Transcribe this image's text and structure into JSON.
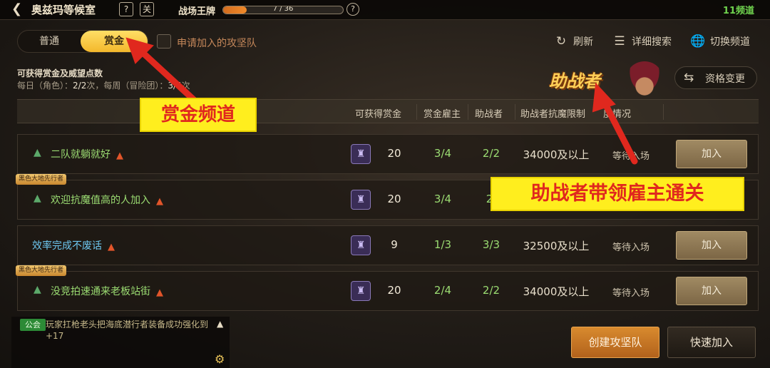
{
  "topbar": {
    "back_icon": "back-arrow-icon",
    "room_title": "奥兹玛等候室",
    "help_glyph": "?",
    "calendar_glyph": "关",
    "rank_label": "战场王牌",
    "rank_progress": "7 / 36",
    "rank_fraction": 0.194,
    "rank_help_glyph": "?",
    "channel": "11频道"
  },
  "mode_toggle": {
    "normal": "普通",
    "bounty": "赏金",
    "selected": "bounty"
  },
  "apply_filter": {
    "label": "申请加入的攻坚队",
    "checked": false
  },
  "actions": {
    "refresh": "刷新",
    "detail_search": "详细搜索",
    "switch_channel": "切换频道"
  },
  "reward_info": {
    "title": "可获得赏金及威望点数",
    "daily_prefix": "每日（角色）：",
    "daily_value": "2/2",
    "daily_suffix": "次，每周（冒险团）：",
    "weekly_value": "3/4",
    "weekly_suffix": "次"
  },
  "helper_badge": "助战者",
  "qualification_button": "资格变更",
  "table": {
    "headers": {
      "reward": "可获得赏金",
      "employer": "赏金雇主",
      "helper": "助战者",
      "limit": "助战者抗魔限制",
      "progress": "度情况"
    },
    "rows": [
      {
        "tag": "",
        "name": "二队就躺就好",
        "name_color": "green",
        "reward": "20",
        "employer": "3/4",
        "helper": "2/2",
        "limit": "34000及以上",
        "status": "等待入场",
        "join": "加入"
      },
      {
        "tag": "黑色大地先行者",
        "name": "欢迎抗魔值高的人加入",
        "name_color": "green",
        "reward": "20",
        "employer": "3/4",
        "helper": "2/",
        "limit": "",
        "status": "",
        "join": ""
      },
      {
        "tag": "",
        "name": "效率完成不废话",
        "name_color": "blue",
        "reward": "9",
        "employer": "1/3",
        "helper": "3/3",
        "limit": "32500及以上",
        "status": "等待入场",
        "join": "加入"
      },
      {
        "tag": "黑色大地先行者",
        "name": "没竞拍速通来老板站街",
        "name_color": "green",
        "reward": "20",
        "employer": "2/4",
        "helper": "2/2",
        "limit": "34000及以上",
        "status": "等待入场",
        "join": "加入"
      }
    ]
  },
  "chat": {
    "guild_tag": "公会",
    "message": "玩家扛枪老头把海底潜行者装备成功强化到+17"
  },
  "buttons": {
    "create": "创建攻坚队",
    "quick_join": "快速加入"
  },
  "annotations": {
    "bounty_channel": "赏金频道",
    "helper_note": "助战者带领雇主通关",
    "color": "#e0281e"
  }
}
